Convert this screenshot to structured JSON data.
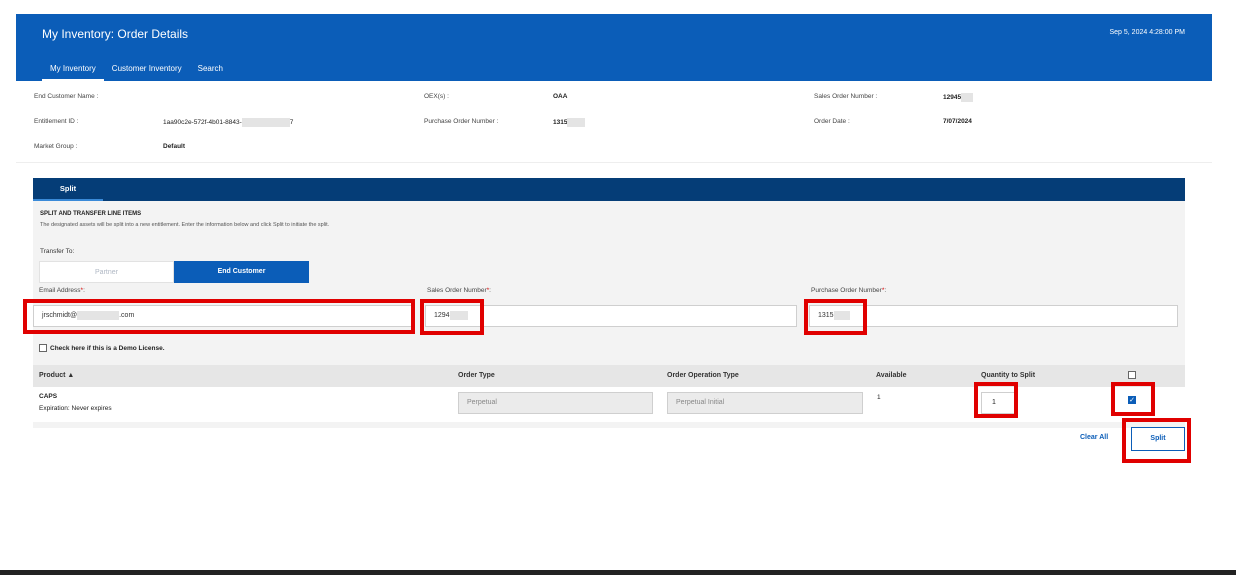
{
  "header": {
    "title": "My Inventory: Order Details",
    "datetime": "Sep 5, 2024 4:28:00 PM",
    "tabs": [
      {
        "label": "My Inventory",
        "active": true
      },
      {
        "label": "Customer Inventory",
        "active": false
      },
      {
        "label": "Search",
        "active": false
      }
    ]
  },
  "order_info": {
    "end_customer_name_label": "End Customer Name :",
    "entitlement_id_label": "Entitlement ID :",
    "entitlement_id_value_start": "1aa90c2e-572f-4b01-8843-",
    "entitlement_id_value_end": "7",
    "market_group_label": "Market Group :",
    "market_group_value": "Default",
    "oex_label": "OEX(s) :",
    "oex_value": "OAA",
    "po_number_label": "Purchase Order Number :",
    "po_number_value": "1315",
    "so_number_label": "Sales Order Number :",
    "so_number_value": "12945",
    "order_date_label": "Order Date :",
    "order_date_value": "7/07/2024"
  },
  "split_panel": {
    "tab_label": "Split",
    "section_title": "SPLIT AND TRANSFER LINE ITEMS",
    "section_desc": "The designated assets will be split into a new entitlement. Enter the information below and click Split to initiate the split.",
    "transfer_to_label": "Transfer To:",
    "transfer_options": [
      "Partner",
      "End Customer"
    ],
    "transfer_selected": "End Customer",
    "email_label": "Email Address",
    "email_value_start": "jrschmidt@",
    "email_value_end": ".com",
    "so_label": "Sales Order Number",
    "so_value": "1294",
    "po_label": "Purchase Order Number",
    "po_value": "1315",
    "required_mark": "*",
    "label_suffix": ":",
    "demo_label": "Check here if this is a Demo License.",
    "table_headers": [
      "Product ▲",
      "Order Type",
      "Order Operation Type",
      "Available",
      "Quantity to Split"
    ],
    "rows": [
      {
        "product": "CAPS",
        "expiration": "Expiration: Never expires",
        "order_type": "Perpetual",
        "order_operation_type": "Perpetual Initial",
        "available": "1",
        "quantity_to_split": "1",
        "selected": true
      }
    ],
    "clear_all_label": "Clear All",
    "split_button_label": "Split"
  },
  "colors": {
    "header_blue": "#0b5db8",
    "panel_navy": "#053d77",
    "highlight_red": "#e00000"
  }
}
